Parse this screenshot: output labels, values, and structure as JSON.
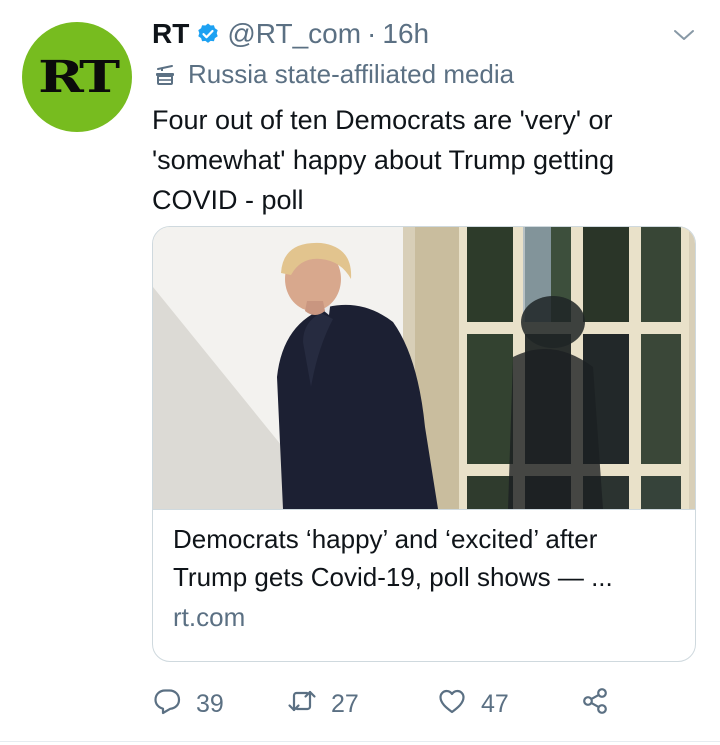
{
  "author": {
    "avatar_text": "RT",
    "name": "RT",
    "handle": "@RT_com",
    "separator": "·",
    "time": "16h",
    "label": "Russia state-affiliated media"
  },
  "tweet": {
    "text": "Four out of ten Democrats are 'very' or 'somewhat' happy about Trump getting COVID - poll"
  },
  "card": {
    "title": "Democrats ‘happy’ and ‘excited’ after Trump gets Covid-19, poll shows — ...",
    "domain": "rt.com"
  },
  "actions": {
    "replies": "39",
    "retweets": "27",
    "likes": "47"
  },
  "colors": {
    "brand_green": "#77bc1f",
    "verified_blue": "#1da1f2",
    "secondary_text": "#5b7083",
    "border": "#cfd9de"
  },
  "icons": [
    "verified-icon",
    "caret-down-icon",
    "podium-icon",
    "reply-icon",
    "retweet-icon",
    "like-icon",
    "share-icon"
  ]
}
